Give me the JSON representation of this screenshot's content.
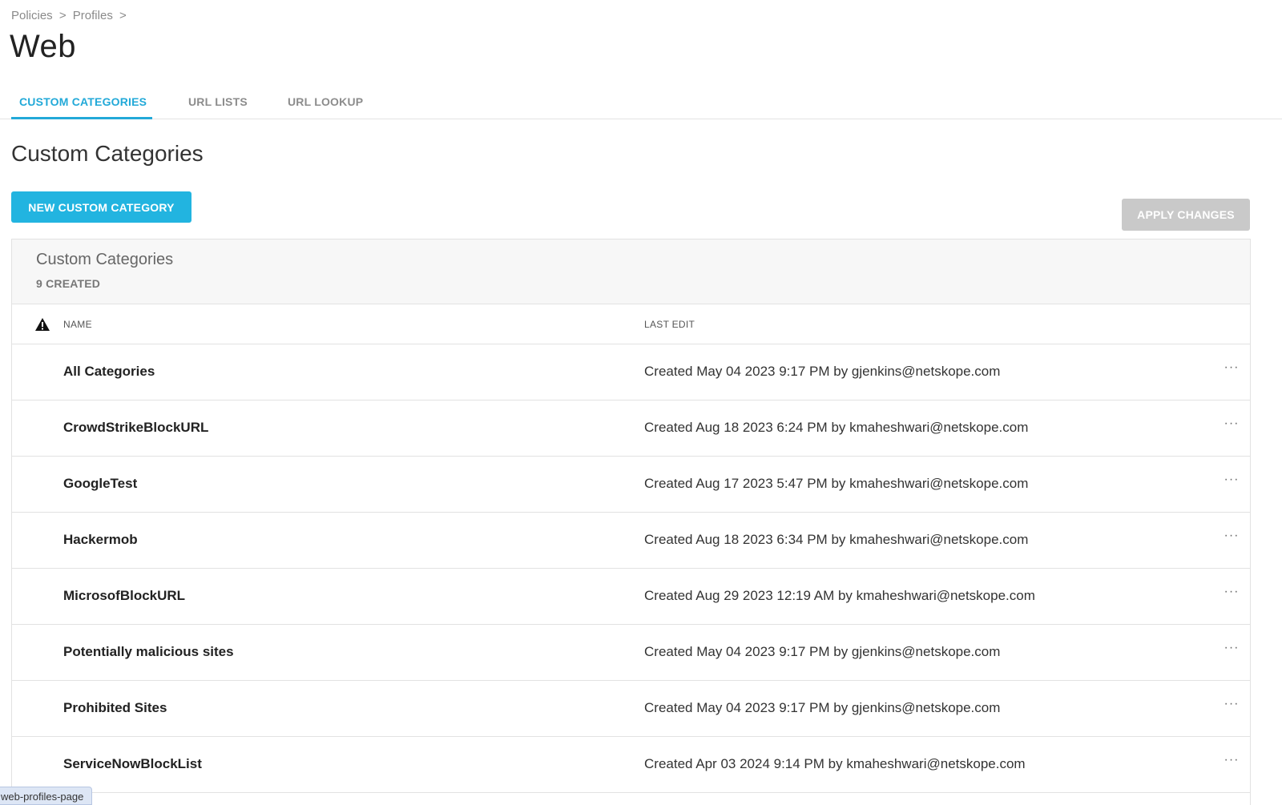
{
  "breadcrumb": {
    "items": [
      "Policies",
      ">",
      "Profiles",
      ">"
    ]
  },
  "page": {
    "title": "Web"
  },
  "tabs": [
    {
      "label": "CUSTOM CATEGORIES",
      "active": true
    },
    {
      "label": "URL LISTS",
      "active": false
    },
    {
      "label": "URL LOOKUP",
      "active": false
    }
  ],
  "section": {
    "title": "Custom Categories"
  },
  "actions": {
    "new_label": "NEW CUSTOM CATEGORY",
    "apply_label": "APPLY CHANGES"
  },
  "panel": {
    "title": "Custom Categories",
    "count": "9 CREATED"
  },
  "table": {
    "columns": {
      "name": "NAME",
      "last_edit": "LAST EDIT"
    },
    "more_glyph": "···",
    "rows": [
      {
        "name": "All Categories",
        "last_edit": "Created May 04 2023 9:17 PM by gjenkins@netskope.com"
      },
      {
        "name": "CrowdStrikeBlockURL",
        "last_edit": "Created Aug 18 2023 6:24 PM by kmaheshwari@netskope.com"
      },
      {
        "name": "GoogleTest",
        "last_edit": "Created Aug 17 2023 5:47 PM by kmaheshwari@netskope.com"
      },
      {
        "name": "Hackermob",
        "last_edit": "Created Aug 18 2023 6:34 PM by kmaheshwari@netskope.com"
      },
      {
        "name": "MicrosofBlockURL",
        "last_edit": "Created Aug 29 2023 12:19 AM by kmaheshwari@netskope.com"
      },
      {
        "name": "Potentially malicious sites",
        "last_edit": "Created May 04 2023 9:17 PM by gjenkins@netskope.com"
      },
      {
        "name": "Prohibited Sites",
        "last_edit": "Created May 04 2023 9:17 PM by gjenkins@netskope.com"
      },
      {
        "name": "ServiceNowBlockList",
        "last_edit": "Created Apr 03 2024 9:14 PM by kmaheshwari@netskope.com"
      }
    ]
  },
  "status_tooltip": "web-profiles-page",
  "colors": {
    "accent": "#22a9d8",
    "primary_button": "#22b4e0",
    "disabled_button": "#c9c9c9"
  },
  "icons": {
    "warning": "warning-triangle-icon",
    "more": "more-options-icon"
  }
}
